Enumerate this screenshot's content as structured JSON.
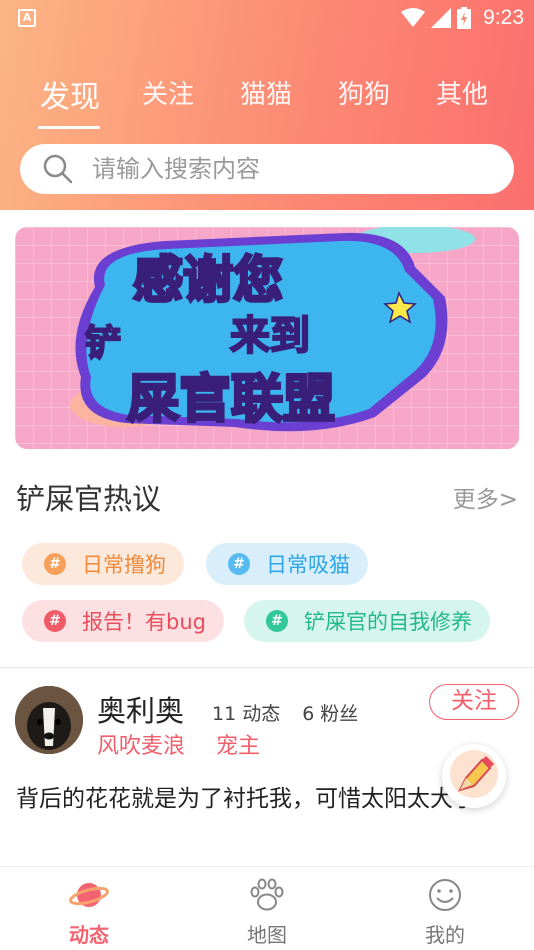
{
  "status_bar": {
    "app_badge": "A",
    "time": "9:23"
  },
  "tabs": [
    "发现",
    "关注",
    "猫猫",
    "狗狗",
    "其他"
  ],
  "search": {
    "placeholder": "请输入搜索内容"
  },
  "banner": {
    "line1": "感谢您",
    "line2_small": "铲",
    "line2": "来到",
    "line3": "屎官联盟"
  },
  "hot_topics": {
    "title": "铲屎官热议",
    "more": "更多>",
    "chips": [
      "日常撸狗",
      "日常吸猫",
      "报告！有bug",
      "铲屎官的自我修养"
    ],
    "chip_icon": "#"
  },
  "post": {
    "author": "奥利奥",
    "posts_count": "11",
    "posts_label": "动态",
    "fans_count": "6",
    "fans_label": "粉丝",
    "follow_label": "关注",
    "tags": [
      "风吹麦浪",
      "宠主"
    ],
    "content": "背后的花花就是为了衬托我，可惜太阳太大了"
  },
  "bottom_nav": [
    {
      "label": "动态",
      "icon": "planet-icon",
      "active": true
    },
    {
      "label": "地图",
      "icon": "paw-icon",
      "active": false
    },
    {
      "label": "我的",
      "icon": "smiley-icon",
      "active": false
    }
  ],
  "colors": {
    "accent": "#f0606c",
    "header_gradient_start": "#fcb584",
    "header_gradient_end": "#fb6f6d"
  }
}
